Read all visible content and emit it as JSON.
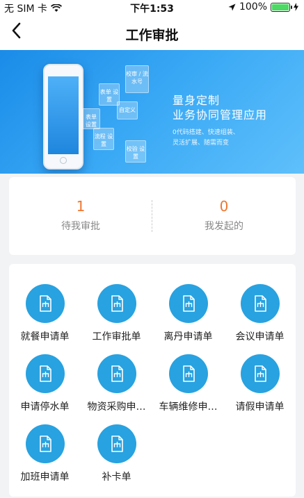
{
  "status_bar": {
    "carrier": "无 SIM 卡",
    "time": "下午1:53",
    "battery": "100%"
  },
  "nav": {
    "back_icon": "chevron-left-icon",
    "title": "工作审批"
  },
  "banner": {
    "title_line1": "量身定制",
    "title_line2": "业务协同管理应用",
    "desc_line1": "0代码搭建、快速组装、",
    "desc_line2": "灵活扩展、随需而变",
    "tiles": [
      "校审 / 流水号",
      "表单 设置",
      "自定义",
      "表单 设置",
      "流程 设置",
      "校验 设置"
    ]
  },
  "stats": [
    {
      "count": "1",
      "label": "待我审批"
    },
    {
      "count": "0",
      "label": "我发起的"
    }
  ],
  "apps": [
    {
      "label": "就餐申请单",
      "icon": "form-icon"
    },
    {
      "label": "工作审批单",
      "icon": "form-icon"
    },
    {
      "label": "离丹申请单",
      "icon": "form-icon"
    },
    {
      "label": "会议申请单",
      "icon": "form-icon"
    },
    {
      "label": "申请停水单",
      "icon": "form-icon"
    },
    {
      "label": "物资采购申…",
      "icon": "form-icon"
    },
    {
      "label": "车辆维修申…",
      "icon": "form-icon"
    },
    {
      "label": "请假申请单",
      "icon": "form-icon"
    },
    {
      "label": "加班申请单",
      "icon": "form-icon"
    },
    {
      "label": "补卡单",
      "icon": "form-icon"
    }
  ],
  "colors": {
    "accent": "#28a2e0",
    "count": "#f0762f",
    "banner": "#2a9cee"
  }
}
